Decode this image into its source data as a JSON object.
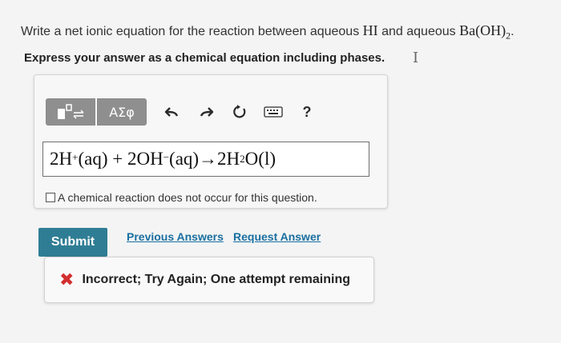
{
  "question": {
    "text_prefix": "Write a net ionic equation for the reaction between aqueous ",
    "reactant1": "HI",
    "text_middle": " and aqueous ",
    "reactant2_base": "Ba(OH)",
    "reactant2_sub": "2",
    "text_suffix": "."
  },
  "instruction": "Express your answer as a chemical equation including phases.",
  "toolbar": {
    "templates_icon": "templates-icon",
    "greek_label": "ΑΣφ",
    "undo_icon": "undo-icon",
    "redo_icon": "redo-icon",
    "reset_icon": "reset-icon",
    "keyboard_icon": "keyboard-icon",
    "help_label": "?"
  },
  "answer": {
    "coef1": "2H",
    "charge1": "+",
    "phase1": " (aq) + 2OH",
    "charge2": "−",
    "phase2": " (aq)→2H",
    "sub_h2o": "2",
    "rest": "O(l)"
  },
  "no_reaction_label": "A chemical reaction does not occur for this question.",
  "buttons": {
    "submit": "Submit",
    "previous_answers": "Previous Answers",
    "request_answer": "Request Answer"
  },
  "feedback": {
    "icon": "x-icon",
    "text": "Incorrect; Try Again; One attempt remaining",
    "color": "#d32f2f"
  },
  "colors": {
    "submit_bg": "#2f7d94",
    "link": "#1a6fa0",
    "toolbar_btn": "#8f8f8f"
  }
}
